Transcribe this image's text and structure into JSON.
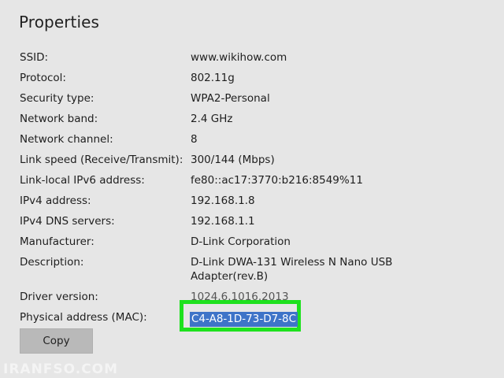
{
  "title": "Properties",
  "properties": [
    {
      "label": "SSID:",
      "value": "www.wikihow.com"
    },
    {
      "label": "Protocol:",
      "value": "802.11g"
    },
    {
      "label": "Security type:",
      "value": "WPA2-Personal"
    },
    {
      "label": "Network band:",
      "value": "2.4 GHz"
    },
    {
      "label": "Network channel:",
      "value": "8"
    },
    {
      "label": "Link speed (Receive/Transmit):",
      "value": "300/144 (Mbps)"
    },
    {
      "label": "Link-local IPv6 address:",
      "value": "fe80::ac17:3770:b216:8549%11"
    },
    {
      "label": "IPv4 address:",
      "value": "192.168.1.8"
    },
    {
      "label": "IPv4 DNS servers:",
      "value": "192.168.1.1"
    },
    {
      "label": "Manufacturer:",
      "value": "D-Link Corporation"
    },
    {
      "label": "Description:",
      "value": "D-Link DWA-131 Wireless N Nano USB Adapter(rev.B)"
    },
    {
      "label": "Driver version:",
      "value": "1024.6.1016.2013"
    }
  ],
  "mac": {
    "label": "Physical address (MAC):",
    "value": "C4-A8-1D-73-D7-8C"
  },
  "copy_button": {
    "label": "Copy"
  },
  "watermark": "IRANFSO.COM",
  "colors": {
    "background": "#e6e6e6",
    "highlight_border": "#1ee11e",
    "selection": "#3e74c8",
    "button": "#b9b9b9"
  }
}
